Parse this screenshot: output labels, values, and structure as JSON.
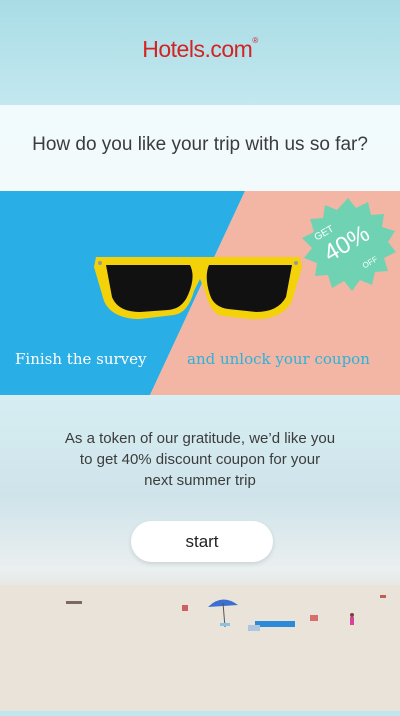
{
  "brand": {
    "name": "Hotels.com",
    "color": "#d32323"
  },
  "survey": {
    "question": "How do you like your trip with us so far?"
  },
  "promo": {
    "left_caption": "Finish the survey",
    "right_caption": "and unlock your coupon",
    "badge": {
      "get": "GET",
      "percent": "40%",
      "off": "OFF"
    },
    "colors": {
      "left": "#2aaee6",
      "right": "#f3b5a4",
      "badge": "#6fd3b3",
      "glasses": "#f4d20a"
    }
  },
  "message": {
    "line1": "As a token of our gratitude, we’d like you",
    "line2": "to get 40% discount coupon for your",
    "line3": "next summer trip"
  },
  "cta": {
    "label": "start"
  }
}
